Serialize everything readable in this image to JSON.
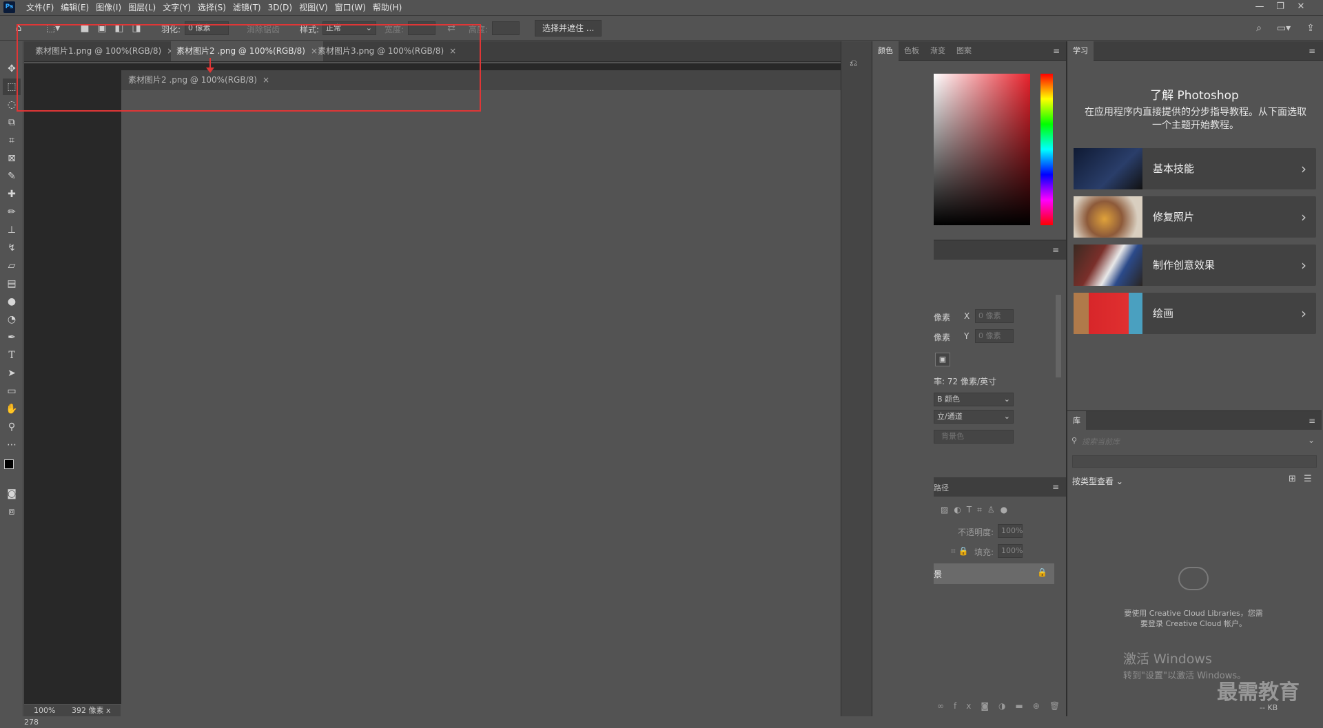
{
  "app": {
    "logo": "Ps"
  },
  "menu": [
    "文件(F)",
    "编辑(E)",
    "图像(I)",
    "图层(L)",
    "文字(Y)",
    "选择(S)",
    "滤镜(T)",
    "3D(D)",
    "视图(V)",
    "窗口(W)",
    "帮助(H)"
  ],
  "window_controls": {
    "minimize": "—",
    "restore": "❐",
    "close": "✕"
  },
  "options": {
    "feather_label": "羽化:",
    "feather_value": "0 像素",
    "antialias_label": "消除锯齿",
    "style_label": "样式:",
    "style_value": "正常",
    "width_label": "宽度:",
    "height_label": "高度:",
    "select_mask_button": "选择并遮住 ..."
  },
  "tabs": [
    {
      "label": "素材图片1.png @ 100%(RGB/8)"
    },
    {
      "label": "素材图片2 .png @ 100%(RGB/8)"
    },
    {
      "label": "素材图片3.png @ 100%(RGB/8)"
    }
  ],
  "floating_window": {
    "title": "素材图片2 .png @ 100%(RGB/8)"
  },
  "status": {
    "zoom": "100%",
    "size": "392 像素 x 278"
  },
  "color_panel": {
    "tabs": [
      "颜色",
      "色板",
      "渐变",
      "图案"
    ]
  },
  "properties": {
    "unit": "像素",
    "x_label": "X",
    "y_label": "Y",
    "x_value": "0 像素",
    "y_value": "0 像素",
    "resolution": "率: 72 像素/英寸",
    "mode": "B 颜色",
    "depth": "立/通道",
    "background": "背景色"
  },
  "layers_panel": {
    "tab_fragment": "路径",
    "opacity_label": "不透明度:",
    "opacity_value": "100%",
    "fill_label": "填充:",
    "fill_value": "100%",
    "layer_fragment": "景"
  },
  "learn_panel": {
    "tab": "学习",
    "title": "了解 Photoshop",
    "subtitle": "在应用程序内直接提供的分步指导教程。从下面选取一个主题开始教程。",
    "cards": [
      {
        "label": "基本技能",
        "thumb": "#223050"
      },
      {
        "label": "修复照片",
        "thumb": "#b89060"
      },
      {
        "label": "制作创意效果",
        "thumb": "#5a4a3e"
      },
      {
        "label": "绘画",
        "thumb": "#c0282c"
      }
    ]
  },
  "library_panel": {
    "tab": "库",
    "search_placeholder": "搜索当前库",
    "view_label": "按类型查看",
    "message": "要使用 Creative Cloud Libraries，您需要登录 Creative Cloud 帐户。",
    "size_label": "-- KB"
  },
  "watermark": {
    "activate_title": "激活 Windows",
    "activate_sub": "转到\"设置\"以激活 Windows。",
    "brand": "最需教育"
  },
  "accent": {
    "annotation_red": "#e03636",
    "ps_blue": "#31a8ff"
  }
}
